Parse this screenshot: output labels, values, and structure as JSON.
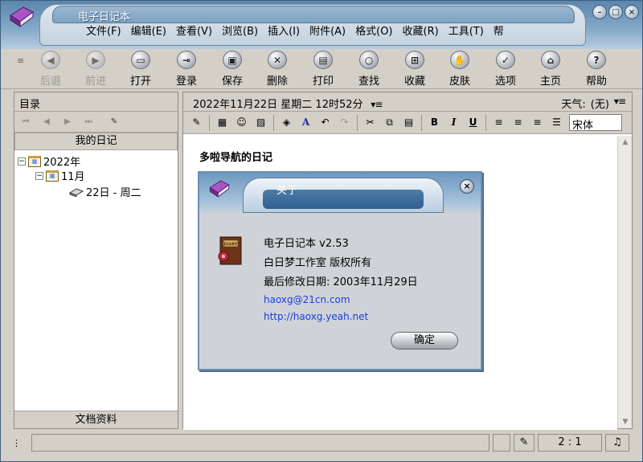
{
  "window": {
    "title": "电子日记本",
    "controls": [
      "minimize",
      "maximize",
      "close"
    ]
  },
  "menu": [
    "文件(F)",
    "编辑(E)",
    "查看(V)",
    "浏览(B)",
    "插入(I)",
    "附件(A)",
    "格式(O)",
    "收藏(R)",
    "工具(T)",
    "帮"
  ],
  "toolbar": {
    "buttons": [
      {
        "label": "后退",
        "icon": "back-icon",
        "enabled": false
      },
      {
        "label": "前进",
        "icon": "forward-icon",
        "enabled": false
      },
      {
        "label": "打开",
        "icon": "open-icon",
        "enabled": true
      },
      {
        "label": "登录",
        "icon": "key-icon",
        "enabled": true
      },
      {
        "label": "保存",
        "icon": "save-icon",
        "enabled": true
      },
      {
        "label": "删除",
        "icon": "delete-icon",
        "enabled": true
      },
      {
        "label": "打印",
        "icon": "print-icon",
        "enabled": true
      },
      {
        "label": "查找",
        "icon": "search-icon",
        "enabled": true
      },
      {
        "label": "收藏",
        "icon": "favorite-icon",
        "enabled": true
      },
      {
        "label": "皮肤",
        "icon": "skin-icon",
        "enabled": true
      },
      {
        "label": "选项",
        "icon": "options-icon",
        "enabled": true
      },
      {
        "label": "主页",
        "icon": "home-icon",
        "enabled": true
      },
      {
        "label": "帮助",
        "icon": "help-icon",
        "enabled": true
      }
    ]
  },
  "left_panel": {
    "header": "目录",
    "section": "我的日记",
    "tree": {
      "year": "2022年",
      "month": "11月",
      "day": "22日 - 周二"
    },
    "footer": "文档资料"
  },
  "right_panel": {
    "date": "2022年11月22日 星期二 12时52分",
    "weather_label": "天气:",
    "weather_value": "(无)",
    "font": "宋体",
    "doc_title": "多啦导航的日记"
  },
  "statusbar": {
    "position": "2 : 1"
  },
  "about": {
    "title": "关于",
    "app_name": "电子日记本 v2.53",
    "copyright": "白日梦工作室 版权所有",
    "modified": "最后修改日期: 2003年11月29日",
    "email": "haoxg@21cn.com",
    "url": "http://haoxg.yeah.net",
    "ok": "确定",
    "diary_label": "DIARY"
  },
  "colors": {
    "chrome": "#d4d0c8",
    "skin_blue": "#6e98c0",
    "link": "#1a3ee0"
  }
}
